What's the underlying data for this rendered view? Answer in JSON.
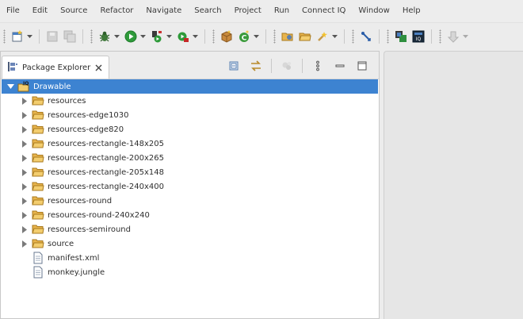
{
  "menubar": {
    "items": [
      "File",
      "Edit",
      "Source",
      "Refactor",
      "Navigate",
      "Search",
      "Project",
      "Run",
      "Connect IQ",
      "Window",
      "Help"
    ]
  },
  "toolbar": {
    "icons": [
      "new-icon",
      "save-icon",
      "save-all-icon",
      "debug-icon",
      "run-icon",
      "run-external-icon",
      "external-tools-icon",
      "new-package-icon",
      "new-class-icon",
      "open-type-icon",
      "open-folder-icon",
      "search-icon",
      "pin-icon",
      "perspective-debug-icon",
      "perspective-monkeyc-icon",
      "next-annotation-icon"
    ]
  },
  "package_explorer": {
    "tab_label": "Package Explorer",
    "tree": [
      {
        "label": "Drawable",
        "type": "project",
        "expanded": true,
        "selected": true
      },
      {
        "label": "resources",
        "type": "folder"
      },
      {
        "label": "resources-edge1030",
        "type": "folder"
      },
      {
        "label": "resources-edge820",
        "type": "folder"
      },
      {
        "label": "resources-rectangle-148x205",
        "type": "folder"
      },
      {
        "label": "resources-rectangle-200x265",
        "type": "folder"
      },
      {
        "label": "resources-rectangle-205x148",
        "type": "folder"
      },
      {
        "label": "resources-rectangle-240x400",
        "type": "folder"
      },
      {
        "label": "resources-round",
        "type": "folder"
      },
      {
        "label": "resources-round-240x240",
        "type": "folder"
      },
      {
        "label": "resources-semiround",
        "type": "folder"
      },
      {
        "label": "source",
        "type": "folder"
      },
      {
        "label": "manifest.xml",
        "type": "file"
      },
      {
        "label": "monkey.jungle",
        "type": "file"
      }
    ]
  },
  "colors": {
    "selection": "#3d83d1",
    "folder": "#e8b44c"
  }
}
